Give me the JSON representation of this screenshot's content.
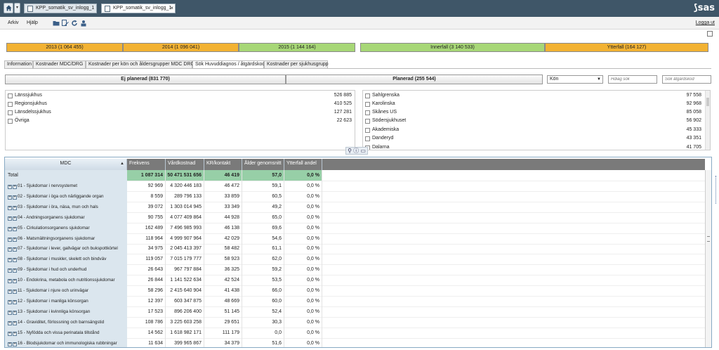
{
  "tabs_bar": {
    "home_icon": "home-icon",
    "documents": [
      {
        "label": "KPP_somatik_sv_inlogg_1",
        "active": false
      },
      {
        "label": "KPP_somatik_sv_inlogg_1",
        "active": true,
        "close": "×"
      }
    ],
    "logo": "sas"
  },
  "menu": {
    "items": [
      "Arkiv",
      "Hjälp"
    ],
    "tools": [
      "folder-open-icon",
      "edit-report-icon",
      "refresh-icon",
      "share-icon"
    ],
    "logout": "Logga ut"
  },
  "year_filters": [
    {
      "label": "2013 (1 064 455)",
      "color": "#f2b233"
    },
    {
      "label": "2014 (1 096 041)",
      "color": "#f2b233"
    },
    {
      "label": "2015 (1 144 164)",
      "color": "#a7d777"
    }
  ],
  "care_filters": [
    {
      "label": "Innerfall (3 140 533)",
      "color": "#a7d777"
    },
    {
      "label": "Ytterfall (164 127)",
      "color": "#f2b233"
    }
  ],
  "report_tabs": [
    {
      "label": "Information",
      "active": false
    },
    {
      "label": "Kostnader MDC/DRG",
      "active": false
    },
    {
      "label": "Kostnader per kön och åldersgrupper MDC DRG",
      "active": false
    },
    {
      "label": "Sök Huvuddiagnos / åtgärdskod",
      "active": true
    },
    {
      "label": "Kostnader per sjukhusgrupp",
      "active": false
    }
  ],
  "planning": {
    "unplanned": "Ej planerad (831 770)",
    "planned": "Planerad (255 544)"
  },
  "gender_select": {
    "value": "Kön"
  },
  "search": {
    "diagnosis_placeholder": "Hdiag sök",
    "procedure_placeholder": "Sök åtgärdskod"
  },
  "hospital_types": [
    {
      "label": "Länssjukhus",
      "value": "526 885"
    },
    {
      "label": "Regionsjukhus",
      "value": "410 525"
    },
    {
      "label": "Länsdelssjukhus",
      "value": "127 281"
    },
    {
      "label": "Övriga",
      "value": "22 623"
    }
  ],
  "hospitals": [
    {
      "label": "Sahlgrenska",
      "value": "97 558"
    },
    {
      "label": "Karolinska",
      "value": "92 968"
    },
    {
      "label": "Skånes US",
      "value": "85 058"
    },
    {
      "label": "Södersjukhuset",
      "value": "56 902"
    },
    {
      "label": "Akademiska",
      "value": "45 333"
    },
    {
      "label": "Danderyd",
      "value": "43 351"
    },
    {
      "label": "Dalarna",
      "value": "41 705"
    }
  ],
  "filter_icons": "filter-info-close-icons",
  "table": {
    "headers": {
      "mdc": "MDC",
      "sort": "▲",
      "freq": "Frekvens",
      "cost": "Vårdkostnad",
      "kr": "KR/kontakt",
      "age": "Ålder genomsnitt",
      "ytter": "Ytterfall andel"
    },
    "total": {
      "name": "Total",
      "freq": "1 087 314",
      "cost": "50 471 531 656",
      "kr": "46 419",
      "age": "57,0",
      "ytter": "0,0 %"
    },
    "rows": [
      {
        "name": "01 - Sjukdomar i nervsystemet",
        "freq": "92 969",
        "cost": "4 320 446 183",
        "kr": "46 472",
        "age": "59,1",
        "ytter": "0,0 %"
      },
      {
        "name": "02 - Sjukdomar i öga och närliggande organ",
        "freq": "8 559",
        "cost": "289 796 133",
        "kr": "33 859",
        "age": "60,5",
        "ytter": "0,0 %"
      },
      {
        "name": "03 - Sjukdomar i öra, näsa, mun och hals",
        "freq": "39 072",
        "cost": "1 303 014 945",
        "kr": "33 349",
        "age": "49,2",
        "ytter": "0,0 %"
      },
      {
        "name": "04 - Andningsorganens sjukdomar",
        "freq": "90 755",
        "cost": "4 077 409 864",
        "kr": "44 928",
        "age": "65,0",
        "ytter": "0,0 %"
      },
      {
        "name": "05 - Cirkulationsorganens sjukdomar",
        "freq": "162 489",
        "cost": "7 496 985 993",
        "kr": "46 138",
        "age": "69,6",
        "ytter": "0,0 %"
      },
      {
        "name": "06 - Matsmältningsorganens sjukdomar",
        "freq": "118 964",
        "cost": "4 999 907 964",
        "kr": "42 029",
        "age": "54,6",
        "ytter": "0,0 %"
      },
      {
        "name": "07 - Sjukdomar i lever, gallvägar och bukspottkörtel",
        "freq": "34 975",
        "cost": "2 045 413 397",
        "kr": "58 482",
        "age": "61,1",
        "ytter": "0,0 %"
      },
      {
        "name": "08 - Sjukdomar i muskler, skelett och bindväv",
        "freq": "119 057",
        "cost": "7 015 179 777",
        "kr": "58 923",
        "age": "62,0",
        "ytter": "0,0 %"
      },
      {
        "name": "09 - Sjukdomar i hud och underhud",
        "freq": "26 643",
        "cost": "967 797 884",
        "kr": "36 325",
        "age": "59,2",
        "ytter": "0,0 %"
      },
      {
        "name": "10 - Endokrina, metabola och nutritionssjukdomar",
        "freq": "26 844",
        "cost": "1 141 522 634",
        "kr": "42 524",
        "age": "53,5",
        "ytter": "0,0 %"
      },
      {
        "name": "11 - Sjukdomar i njure och urinvägar",
        "freq": "58 296",
        "cost": "2 415 640 904",
        "kr": "41 438",
        "age": "66,0",
        "ytter": "0,0 %"
      },
      {
        "name": "12 - Sjukdomar i manliga könsorgan",
        "freq": "12 397",
        "cost": "603 347 875",
        "kr": "48 669",
        "age": "60,0",
        "ytter": "0,0 %"
      },
      {
        "name": "13 - Sjukdomar i kvinnliga könsorgan",
        "freq": "17 523",
        "cost": "896 206 400",
        "kr": "51 145",
        "age": "52,4",
        "ytter": "0,0 %"
      },
      {
        "name": "14 - Graviditet, förlossning och barnsängstid",
        "freq": "108 786",
        "cost": "3 225 603 258",
        "kr": "29 651",
        "age": "30,3",
        "ytter": "0,0 %"
      },
      {
        "name": "15 - Nyfödda och vissa perinatala tillstånd",
        "freq": "14 562",
        "cost": "1 618 982 171",
        "kr": "111 179",
        "age": "0,0",
        "ytter": "0,0 %"
      },
      {
        "name": "16 - Blodsjukdomar och immunologiska rubbningar",
        "freq": "11 634",
        "cost": "399 965 867",
        "kr": "34 379",
        "age": "51,6",
        "ytter": "0,0 %"
      }
    ]
  }
}
